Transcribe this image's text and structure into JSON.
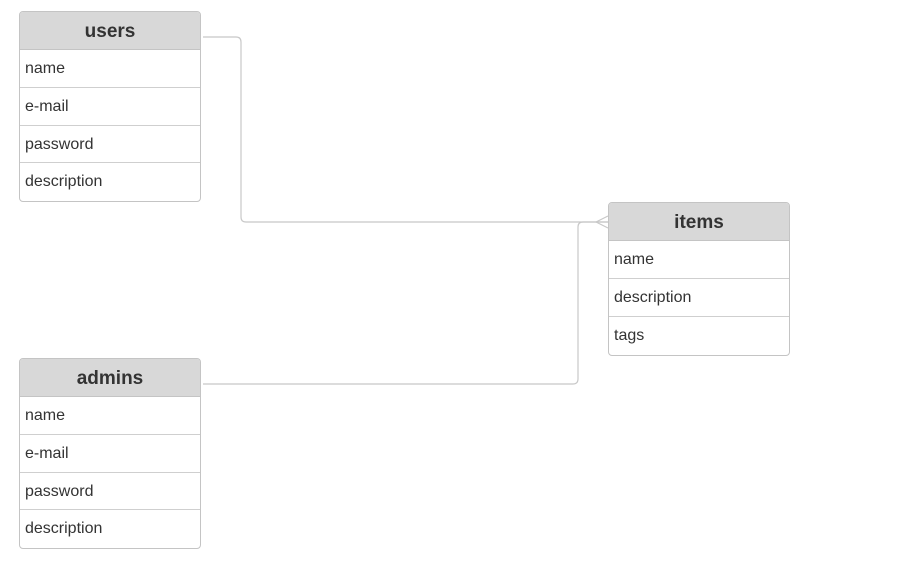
{
  "tables": {
    "users": {
      "title": "users",
      "fields": [
        "name",
        "e-mail",
        "password",
        "description"
      ]
    },
    "admins": {
      "title": "admins",
      "fields": [
        "name",
        "e-mail",
        "password",
        "description"
      ]
    },
    "items": {
      "title": "items",
      "fields": [
        "name",
        "description",
        "tags"
      ]
    }
  },
  "relations": [
    {
      "from": "users",
      "to": "items",
      "to_end": "many"
    },
    {
      "from": "admins",
      "to": "items",
      "to_end": "many"
    }
  ],
  "colors": {
    "header_bg": "#d8d8d8",
    "border": "#c4c4c4",
    "connector": "#c8c8c8",
    "text": "#333333"
  }
}
